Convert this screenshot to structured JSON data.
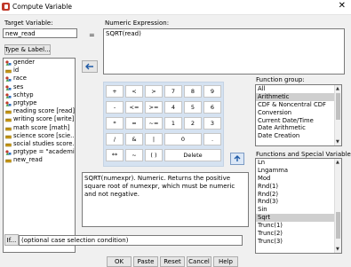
{
  "window": {
    "title": "Compute Variable",
    "close": "✕"
  },
  "target": {
    "label": "Target Variable:",
    "value": "new_read",
    "type_label_btn": "Type & Label..."
  },
  "equals": "=",
  "numeric": {
    "label": "Numeric Expression:",
    "value": "SQRT(read)"
  },
  "variables": [
    {
      "name": "gender",
      "icon": "nominal"
    },
    {
      "name": "id",
      "icon": "scale"
    },
    {
      "name": "race",
      "icon": "nominal"
    },
    {
      "name": "ses",
      "icon": "nominal"
    },
    {
      "name": "schtyp",
      "icon": "nominal"
    },
    {
      "name": "prgtype",
      "icon": "nominal"
    },
    {
      "name": "reading score [read]",
      "icon": "scale"
    },
    {
      "name": "writing score [write]",
      "icon": "scale"
    },
    {
      "name": "math score [math]",
      "icon": "scale"
    },
    {
      "name": "science score [scie...",
      "icon": "scale"
    },
    {
      "name": "social studies score...",
      "icon": "scale"
    },
    {
      "name": "prgtype = \"academic...",
      "icon": "nominal"
    },
    {
      "name": "new_read",
      "icon": "scale"
    }
  ],
  "keypad": {
    "row1": [
      "+",
      "<",
      ">",
      "7",
      "8",
      "9"
    ],
    "row2": [
      "-",
      "<=",
      ">=",
      "4",
      "5",
      "6"
    ],
    "row3": [
      "*",
      "=",
      "~=",
      "1",
      "2",
      "3"
    ],
    "row4": [
      "/",
      "&",
      "|",
      "0",
      "."
    ],
    "row5": [
      "**",
      "~",
      "( )",
      "Delete"
    ]
  },
  "function_group": {
    "label": "Function group:",
    "items": [
      "All",
      "Arithmetic",
      "CDF & Noncentral CDF",
      "Conversion",
      "Current Date/Time",
      "Date Arithmetic",
      "Date Creation"
    ],
    "selected": "Arithmetic"
  },
  "functions": {
    "label": "Functions and Special Variables:",
    "items": [
      "Ln",
      "Lngamma",
      "Mod",
      "Rnd(1)",
      "Rnd(2)",
      "Rnd(3)",
      "Sin",
      "Sqrt",
      "Trunc(1)",
      "Trunc(2)",
      "Trunc(3)"
    ],
    "selected": "Sqrt"
  },
  "description": "SQRT(numexpr). Numeric. Returns the positive square root of numexpr, which must be numeric and not negative.",
  "if_btn": "If...",
  "if_text": "(optional case selection condition)",
  "buttons": {
    "ok": "OK",
    "paste": "Paste",
    "reset": "Reset",
    "cancel": "Cancel",
    "help": "Help"
  },
  "colors": {
    "pad": "#d5e2f1",
    "selected": "#cfcfcf",
    "nominal": "#c0392b",
    "scale": "#d4a017"
  }
}
